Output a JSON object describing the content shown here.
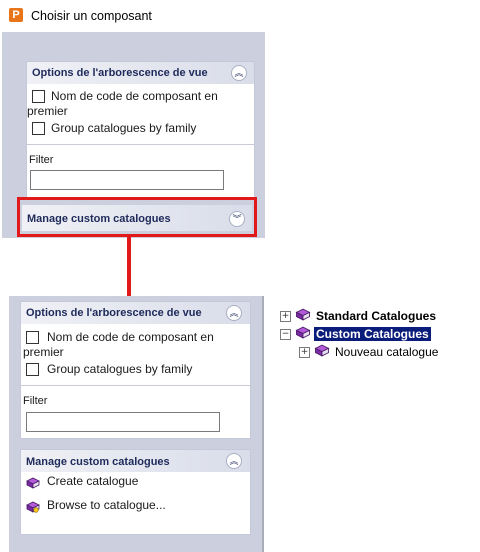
{
  "window": {
    "title": "Choisir un composant",
    "app_icon_letter": "P"
  },
  "view_options": {
    "title": "Options de l'arborescence de vue",
    "checkbox_code_name_line1": "Nom de code de composant en",
    "checkbox_code_name_line2": "premier",
    "checkbox_group": "Group catalogues by family",
    "filter_label": "Filter",
    "filter_value": ""
  },
  "custom_catalogues": {
    "title": "Manage custom catalogues",
    "create": "Create catalogue",
    "browse": "Browse to catalogue..."
  },
  "tree": {
    "standard": "Standard Catalogues",
    "custom": "Custom Catalogues",
    "child": "Nouveau catalogue"
  },
  "colors": {
    "annotation_red": "#e31818",
    "panel_bg": "#ccd0de",
    "selection": "#0a1d7a"
  }
}
